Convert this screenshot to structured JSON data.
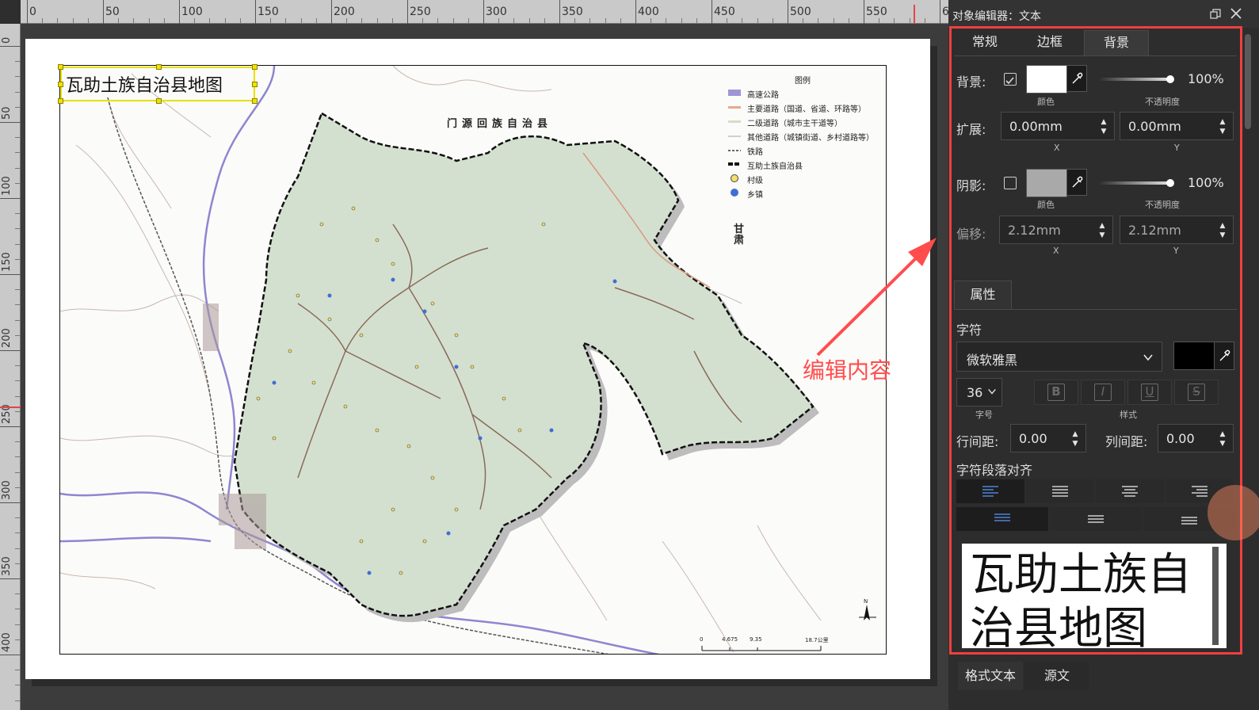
{
  "ruler": {
    "top_labels": [
      "0",
      "50",
      "100",
      "150",
      "200",
      "250",
      "300",
      "350",
      "400",
      "450",
      "500",
      "550",
      "6"
    ],
    "left_labels": [
      "0",
      "50",
      "100",
      "150",
      "200",
      "250",
      "300",
      "350",
      "400"
    ]
  },
  "map": {
    "title": "瓦助土族自治县地图",
    "neighbor_north": "门源回族自治县",
    "neighbor_east": "甘肃",
    "legend": {
      "title": "图例",
      "items": [
        {
          "label": "高速公路",
          "color": "#9c95d6"
        },
        {
          "label": "主要道路（国道、省道、环路等）",
          "color": "#e9a98f"
        },
        {
          "label": "二级道路（城市主干道等）",
          "color": "#d9dbc4"
        },
        {
          "label": "其他道路（城镇街道、乡村道路等）",
          "color": "#cfcfcf"
        },
        {
          "label": "铁路",
          "color": "#666666"
        },
        {
          "label": "互助土族自治县",
          "color": "#111111"
        },
        {
          "label": "村级",
          "color": "#f2e06a"
        },
        {
          "label": "乡镇",
          "color": "#3f6fd2"
        }
      ]
    },
    "scale_labels": [
      "0",
      "4.675",
      "9.35",
      "18.7公里"
    ],
    "north_label": "N",
    "region_fill": "#d3e0cf"
  },
  "annotation": {
    "text": "编辑内容",
    "color": "#ff4d4d"
  },
  "panel": {
    "title": "对象编辑器：文本",
    "tabs": [
      "常规",
      "边框",
      "背景"
    ],
    "active_tab": "背景",
    "background": {
      "label": "背景:",
      "checked": true,
      "color_caption": "颜色",
      "opacity": "100%",
      "opacity_caption": "不透明度"
    },
    "expand": {
      "label": "扩展:",
      "x": "0.00mm",
      "y": "0.00mm",
      "x_caption": "X",
      "y_caption": "Y"
    },
    "shadow": {
      "label": "阴影:",
      "checked": false,
      "color_caption": "颜色",
      "opacity": "100%",
      "opacity_caption": "不透明度"
    },
    "offset": {
      "label": "偏移:",
      "x": "2.12mm",
      "y": "2.12mm",
      "x_caption": "X",
      "y_caption": "Y"
    },
    "properties": {
      "tab": "属性",
      "char_label": "字符",
      "font": "微软雅黑",
      "font_color": "#000000",
      "size": "36",
      "size_caption": "字号",
      "style_caption": "样式",
      "style_buttons": [
        "B",
        "I",
        "U",
        "S"
      ],
      "line_spacing_label": "行间距:",
      "line_spacing": "0.00",
      "col_spacing_label": "列间距:",
      "col_spacing": "0.00",
      "align_label": "字符段落对齐",
      "preview_text": "瓦助土族自治县地图"
    },
    "bottom_tabs": [
      "格式文本",
      "源文"
    ],
    "accent": "#f23f3f"
  }
}
